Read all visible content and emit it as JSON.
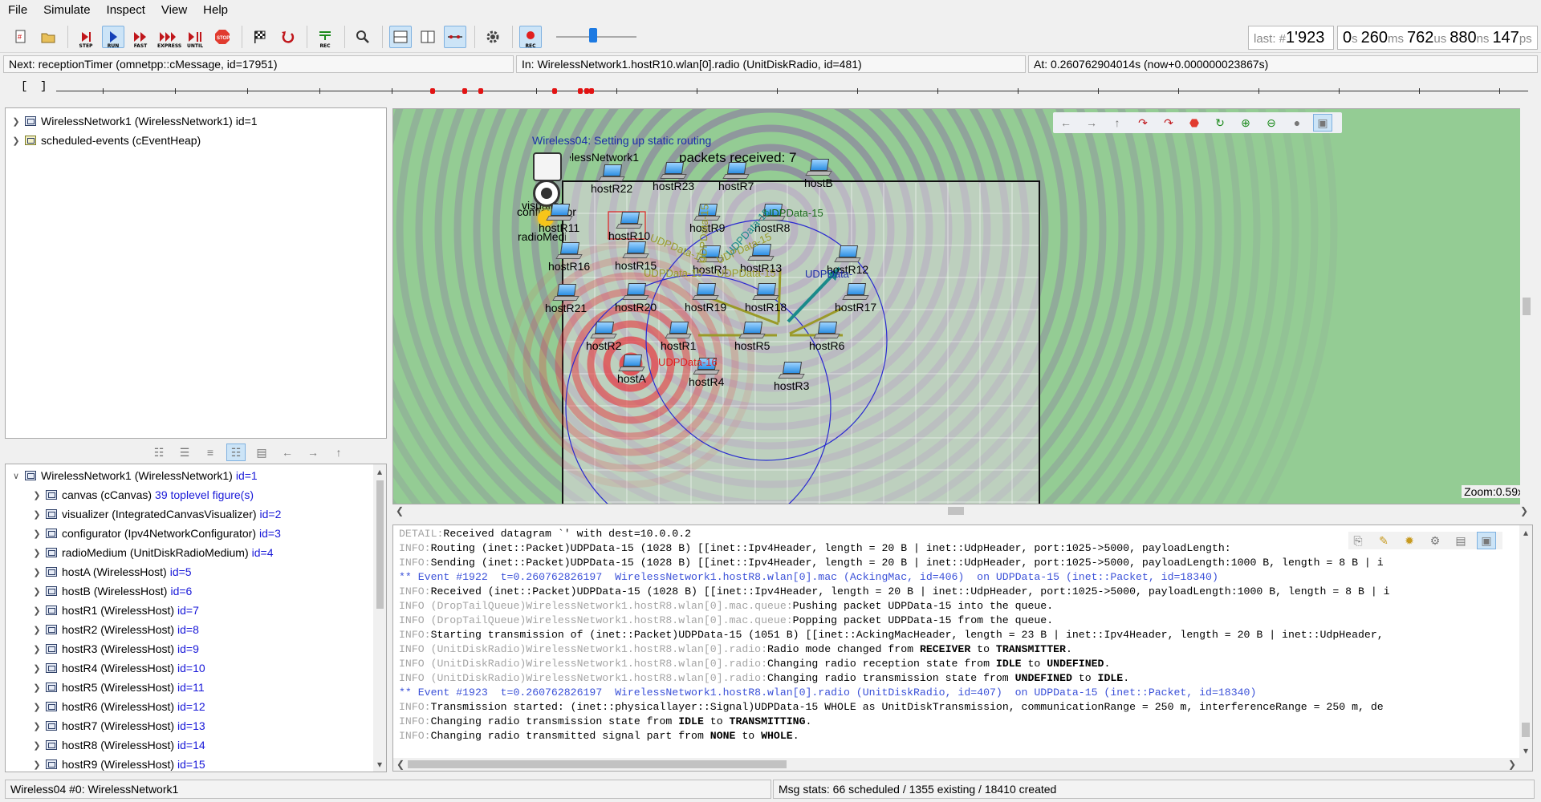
{
  "menu": [
    "File",
    "Simulate",
    "Inspect",
    "View",
    "Help"
  ],
  "toolbar": {
    "step_caption": "STEP",
    "run_caption": "RUN",
    "fast_caption": "FAST",
    "express_caption": "EXPRESS",
    "until_caption": "UNTIL",
    "stop_caption": "STOP",
    "rec_caption": "REC",
    "record_caption": "REC",
    "speed_level": 0.45
  },
  "event_counter": {
    "label": "last: #",
    "value": "1'923"
  },
  "sim_time": {
    "s": "0",
    "s_unit": "s",
    "ms": "260",
    "ms_unit": "ms",
    "us": "762",
    "us_unit": "us",
    "ns": "880",
    "ns_unit": "ns",
    "ps": "147",
    "ps_unit": "ps"
  },
  "status": {
    "next": "Next: receptionTimer (omnetpp::cMessage, id=17951)",
    "in": "In: WirelessNetwork1.hostR10.wlan[0].radio (UnitDiskRadio, id=481)",
    "at": "At: 0.260762904014s (now+0.000000023867s)"
  },
  "timeline": {
    "open_bracket": "[",
    "close_bracket": "]"
  },
  "object_tree": [
    {
      "label": "WirelessNetwork1 (WirelessNetwork1) id=1"
    },
    {
      "label": "scheduled-events (cEventHeap)"
    }
  ],
  "module_tree": {
    "root": {
      "label": "WirelessNetwork1 (WirelessNetwork1)",
      "id": "id=1"
    },
    "children": [
      {
        "label": "canvas (cCanvas)",
        "id": "39 toplevel figure(s)"
      },
      {
        "label": "visualizer (IntegratedCanvasVisualizer)",
        "id": "id=2"
      },
      {
        "label": "configurator (Ipv4NetworkConfigurator)",
        "id": "id=3"
      },
      {
        "label": "radioMedium (UnitDiskRadioMedium)",
        "id": "id=4"
      },
      {
        "label": "hostA (WirelessHost)",
        "id": "id=5"
      },
      {
        "label": "hostB (WirelessHost)",
        "id": "id=6"
      },
      {
        "label": "hostR1 (WirelessHost)",
        "id": "id=7"
      },
      {
        "label": "hostR2 (WirelessHost)",
        "id": "id=8"
      },
      {
        "label": "hostR3 (WirelessHost)",
        "id": "id=9"
      },
      {
        "label": "hostR4 (WirelessHost)",
        "id": "id=10"
      },
      {
        "label": "hostR5 (WirelessHost)",
        "id": "id=11"
      },
      {
        "label": "hostR6 (WirelessHost)",
        "id": "id=12"
      },
      {
        "label": "hostR7 (WirelessHost)",
        "id": "id=13"
      },
      {
        "label": "hostR8 (WirelessHost)",
        "id": "id=14"
      },
      {
        "label": "hostR9 (WirelessHost)",
        "id": "id=15"
      }
    ]
  },
  "canvas": {
    "network_title": "Wireless04: Setting up static routing",
    "network_name": "WirelessNetwork1",
    "packets_received": "packets received: 7",
    "zoom": "Zoom:0.59x",
    "config_label": "configurator",
    "visualizer_label": "visualizer",
    "medium_label": "radioMedium",
    "hosts": [
      "hostR22",
      "hostR23",
      "hostR7",
      "hostB",
      "hostR11",
      "hostR10",
      "hostR9",
      "hostR8",
      "hostR16",
      "hostR15",
      "hostR1",
      "hostR13",
      "hostR12",
      "hostR21",
      "hostR20",
      "hostR19",
      "hostR18",
      "hostR17",
      "hostR2",
      "hostR1",
      "hostR5",
      "hostR6",
      "hostA",
      "hostR4",
      "hostR3"
    ],
    "packets": {
      "p_r8": "UDPData-15",
      "p_r12": "UDPData-",
      "p_a": "UDPData-16",
      "p_mid1": "UDPData-15",
      "p_mid2": "UDPData-15",
      "p_diag1": "UDPData-15",
      "p_diag2": "UDPData-15",
      "p_diag3": "UDPData-15",
      "p_vert": "UDPData-15"
    },
    "colors": {
      "background": "#94cc94",
      "signal_red": "#e8383e",
      "signal_purple": "#8a5aa8",
      "packet_teal": "#1a8a8a"
    }
  },
  "log": [
    {
      "tag": "DETAIL:",
      "text": "Received datagram `' with dest=10.0.0.2"
    },
    {
      "tag": "INFO:",
      "text": "Routing (inet::Packet)UDPData-15 (1028 B) [[inet::Ipv4Header, length = 20 B | inet::UdpHeader, port:1025->5000, payloadLength:"
    },
    {
      "tag": "INFO:",
      "text": "Sending (inet::Packet)UDPData-15 (1028 B) [[inet::Ipv4Header, length = 20 B | inet::UdpHeader, port:1025->5000, payloadLength:1000 B, length = 8 B | i"
    },
    {
      "event": "** Event #1922  t=0.260762826197  WirelessNetwork1.hostR8.wlan[0].mac (AckingMac, id=406)  on UDPData-15 (inet::Packet, id=18340)"
    },
    {
      "tag": "INFO:",
      "text": "Received (inet::Packet)UDPData-15 (1028 B) [[inet::Ipv4Header, length = 20 B | inet::UdpHeader, port:1025->5000, payloadLength:1000 B, length = 8 B | i"
    },
    {
      "tag": "INFO (DropTailQueue)WirelessNetwork1.hostR8.wlan[0].mac.queue:",
      "text": "Pushing packet UDPData-15 into the queue."
    },
    {
      "tag": "INFO (DropTailQueue)WirelessNetwork1.hostR8.wlan[0].mac.queue:",
      "text": "Popping packet UDPData-15 from the queue."
    },
    {
      "tag": "INFO:",
      "text": "Starting transmission of (inet::Packet)UDPData-15 (1051 B) [[inet::AckingMacHeader, length = 23 B | inet::Ipv4Header, length = 20 B | inet::UdpHeader,"
    },
    {
      "tag": "INFO (UnitDiskRadio)WirelessNetwork1.hostR8.wlan[0].radio:",
      "pre": "Radio mode changed from ",
      "b1": "RECEIVER",
      "mid": " to ",
      "b2": "TRANSMITTER",
      "post": "."
    },
    {
      "tag": "INFO (UnitDiskRadio)WirelessNetwork1.hostR8.wlan[0].radio:",
      "pre": "Changing radio reception state from ",
      "b1": "IDLE",
      "mid": " to ",
      "b2": "UNDEFINED",
      "post": "."
    },
    {
      "tag": "INFO (UnitDiskRadio)WirelessNetwork1.hostR8.wlan[0].radio:",
      "pre": "Changing radio transmission state from ",
      "b1": "UNDEFINED",
      "mid": " to ",
      "b2": "IDLE",
      "post": "."
    },
    {
      "event": "** Event #1923  t=0.260762826197  WirelessNetwork1.hostR8.wlan[0].radio (UnitDiskRadio, id=407)  on UDPData-15 (inet::Packet, id=18340)"
    },
    {
      "tag": "INFO:",
      "text": "Transmission started: (inet::physicallayer::Signal)UDPData-15 WHOLE as UnitDiskTransmission, communicationRange = 250 m, interferenceRange = 250 m, de"
    },
    {
      "tag": "INFO:",
      "pre": "Changing radio transmission state from ",
      "b1": "IDLE",
      "mid": " to ",
      "b2": "TRANSMITTING",
      "post": "."
    },
    {
      "tag": "INFO:",
      "pre": "Changing radio transmitted signal part from ",
      "b1": "NONE",
      "mid": " to ",
      "b2": "WHOLE",
      "post": "."
    }
  ],
  "bottom_status": {
    "left": "Wireless04 #0: WirelessNetwork1",
    "right": "Msg stats: 66 scheduled / 1355 existing / 18410 created"
  }
}
